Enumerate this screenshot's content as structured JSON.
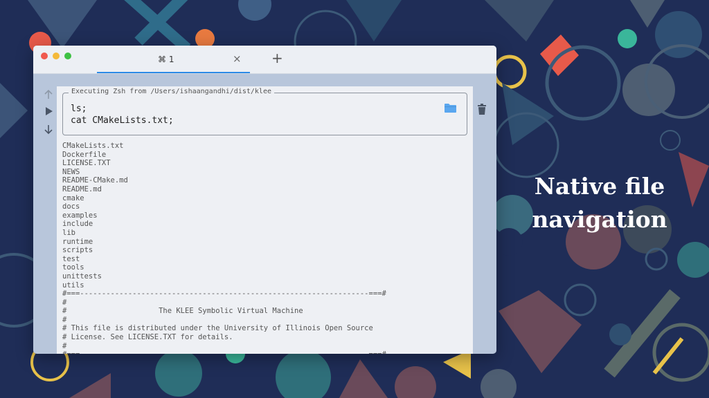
{
  "tab": {
    "label": "⌘ 1",
    "close_glyph": "×"
  },
  "toolbar": {
    "new_tab_glyph": "+"
  },
  "side_controls": [
    "arrow-up-icon",
    "play-icon",
    "arrow-down-icon"
  ],
  "command": {
    "legend": "Executing Zsh from /Users/ishaangandhi/dist/klee",
    "lines": [
      "ls;",
      "cat CMakeLists.txt;"
    ],
    "folder_icon": "folder-icon"
  },
  "output_lines": [
    "CMakeLists.txt",
    "Dockerfile",
    "LICENSE.TXT",
    "NEWS",
    "README-CMake.md",
    "README.md",
    "cmake",
    "docs",
    "examples",
    "include",
    "lib",
    "runtime",
    "scripts",
    "test",
    "tools",
    "unittests",
    "utils",
    "#===------------------------------------------------------------------===#",
    "#",
    "#                     The KLEE Symbolic Virtual Machine",
    "#",
    "# This file is distributed under the University of Illinois Open Source",
    "# License. See LICENSE.TXT for details.",
    "#",
    "#===------------------------------------------------------------------===#"
  ],
  "trash_icon": "trash-icon",
  "headline": {
    "line1": "Native file",
    "line2": "navigation"
  },
  "colors": {
    "background": "#1f2d57",
    "accent_blue": "#2d8ae6",
    "folder_blue": "#5aa7ef",
    "traffic_red": "#f05a4f",
    "traffic_yellow": "#f4b93a",
    "traffic_green": "#3ec144"
  }
}
